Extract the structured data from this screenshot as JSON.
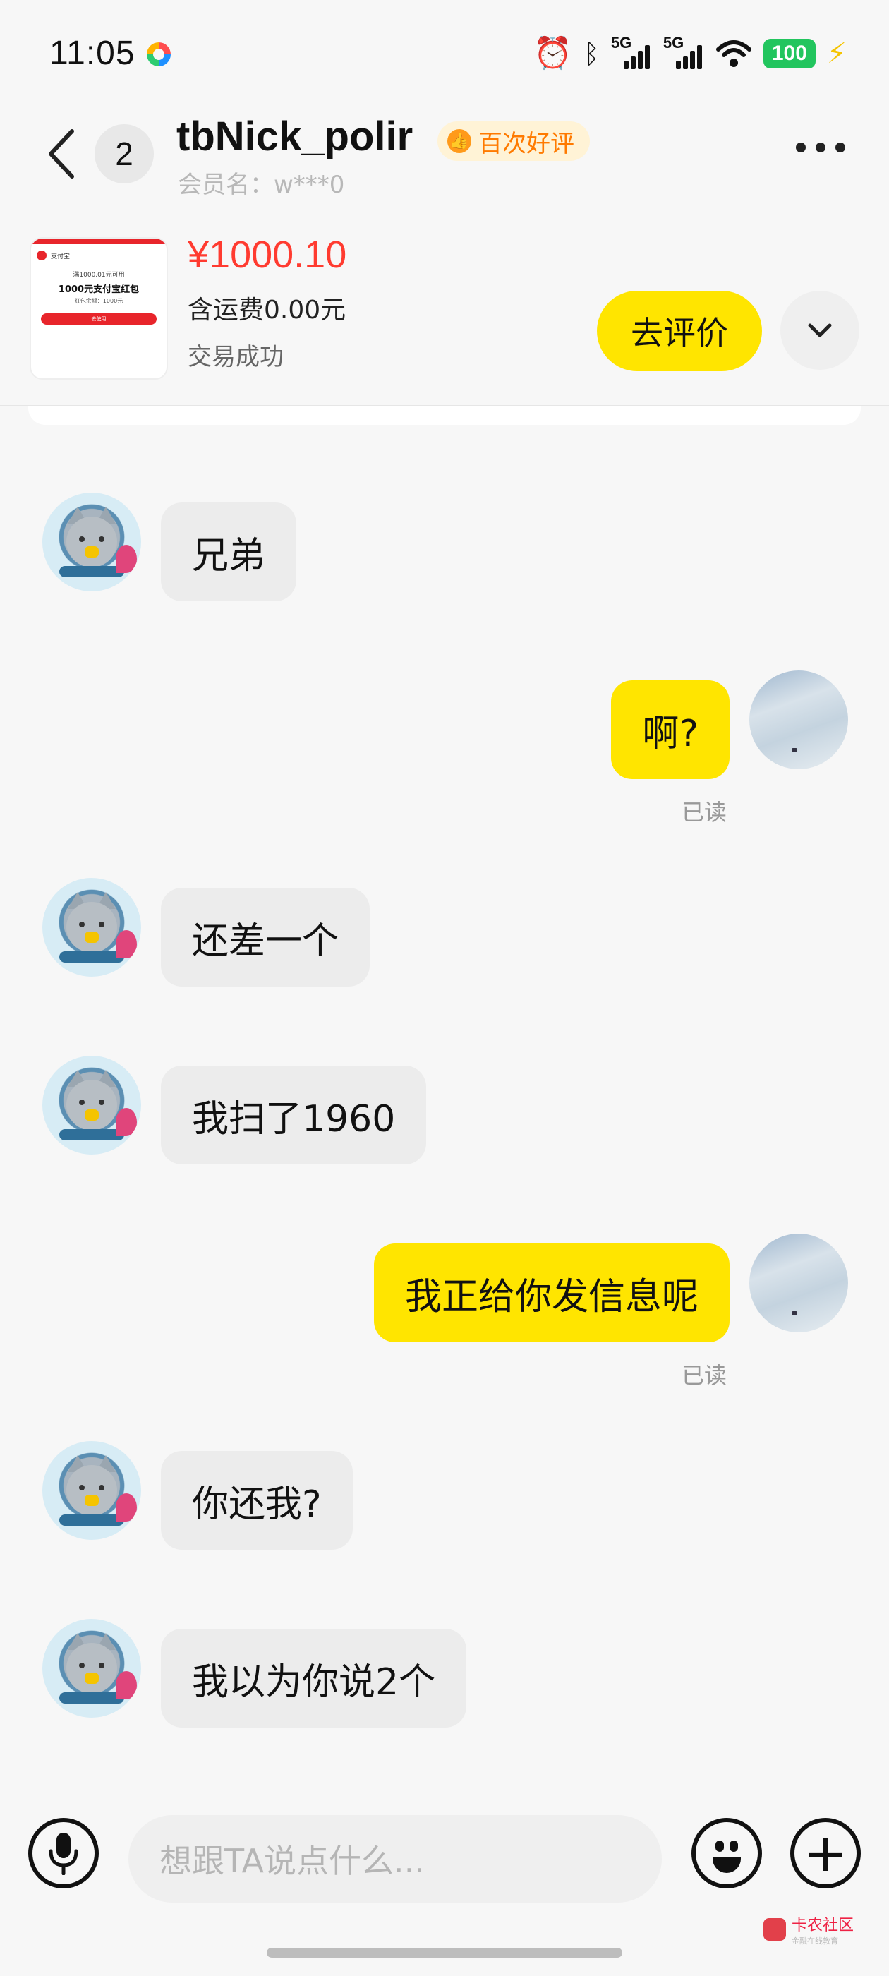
{
  "status_bar": {
    "time": "11:05",
    "network_1": "5G",
    "network_2": "5G",
    "battery": "100"
  },
  "header": {
    "unread_count": "2",
    "nickname": "tbNick_polir",
    "badge": "百次好评",
    "member": "会员名：w***0"
  },
  "order": {
    "thumb_brand": "支付宝",
    "thumb_line1": "满1000.01元可用",
    "thumb_line2": "1000元支付宝红包",
    "thumb_line3": "红包余额：1000元",
    "thumb_button": "去使用",
    "price": "¥1000.10",
    "shipping": "含运费0.00元",
    "status": "交易成功",
    "rate_button": "去评价"
  },
  "messages": [
    {
      "side": "in",
      "text": "兄弟"
    },
    {
      "side": "out",
      "text": "啊?",
      "status": "已读"
    },
    {
      "side": "in",
      "text": "还差一个"
    },
    {
      "side": "in",
      "text": "我扫了1960"
    },
    {
      "side": "out",
      "text": "我正给你发信息呢",
      "status": "已读"
    },
    {
      "side": "in",
      "text": "你还我?"
    },
    {
      "side": "in",
      "text": "我以为你说2个"
    }
  ],
  "input": {
    "placeholder": "想跟TA说点什么..."
  },
  "watermark": {
    "title": "卡农社区",
    "subtitle": "金融在线教育"
  },
  "colors": {
    "accent_yellow": "#ffe500",
    "price_red": "#ff3b30",
    "badge_orange": "#ff7a00"
  }
}
